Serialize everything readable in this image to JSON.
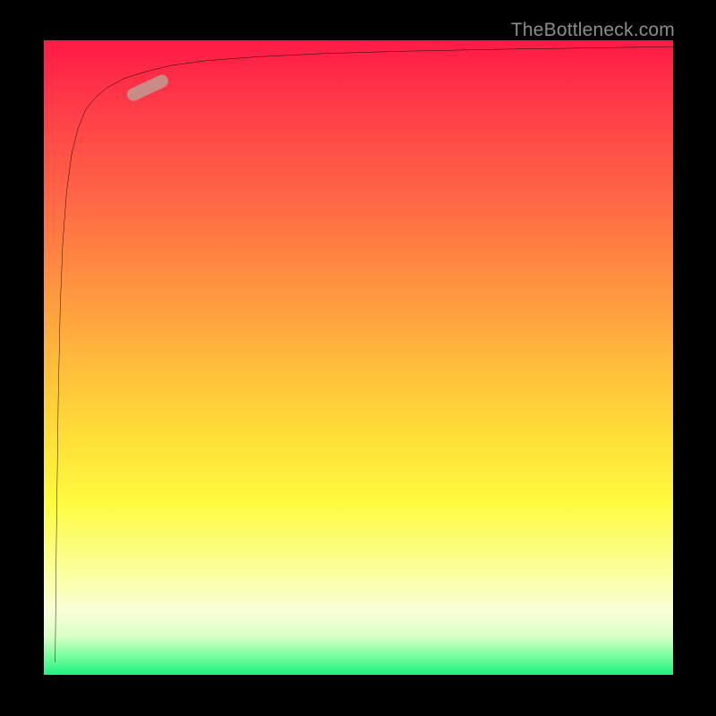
{
  "watermark": {
    "text": "TheBottleneck.com"
  },
  "colors": {
    "background": "#000000",
    "curve": "#000000",
    "marker_fill": "#c98b86",
    "marker_stroke": "#b87a76",
    "gradient_stops": [
      "#ff1a45",
      "#ff3a48",
      "#ff6a45",
      "#ff9840",
      "#ffbf3b",
      "#ffe038",
      "#fffb40",
      "#fbffa0",
      "#faffd8",
      "#d8ffc6",
      "#7bff9e",
      "#1eef82"
    ]
  },
  "chart_data": {
    "type": "line",
    "title": "",
    "xlabel": "",
    "ylabel": "",
    "xlim": [
      0,
      100
    ],
    "ylim": [
      0,
      100
    ],
    "grid": false,
    "legend": false,
    "series": [
      {
        "name": "curve",
        "x": [
          1.8,
          2.0,
          2.3,
          2.6,
          3.0,
          3.6,
          4.4,
          5.4,
          6.6,
          8.2,
          10.0,
          12.8,
          16.0,
          20.0,
          26.0,
          34.0,
          44.0,
          58.0,
          74.0,
          88.0,
          100.0
        ],
        "y": [
          2.0,
          22.0,
          44.0,
          58.0,
          68.0,
          76.0,
          82.0,
          86.0,
          89.0,
          91.0,
          92.5,
          94.0,
          95.0,
          96.0,
          96.8,
          97.4,
          97.9,
          98.3,
          98.6,
          98.8,
          99.0
        ]
      }
    ],
    "marker": {
      "name": "highlight",
      "shape": "capsule",
      "center_x_pct": 16.5,
      "center_y_pct": 92.5,
      "length_pct": 7.0,
      "thickness_pct": 2.0,
      "angle_deg": -25
    },
    "background_gradient": {
      "direction": "vertical",
      "top": "red",
      "bottom": "green"
    }
  }
}
